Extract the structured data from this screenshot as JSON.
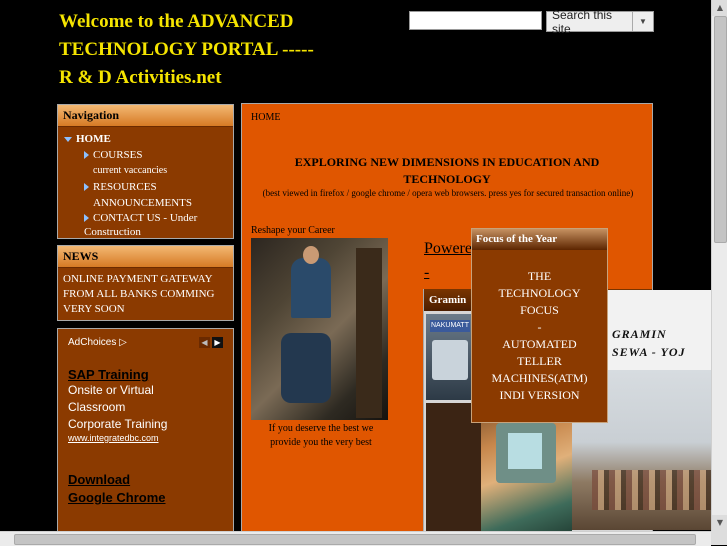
{
  "header": {
    "title_line1": "Welcome to the ADVANCED",
    "title_line2": "TECHNOLOGY PORTAL -----",
    "title_line3": "R & D Activities.net"
  },
  "search": {
    "placeholder": "",
    "button_label": "Search this site"
  },
  "navigation": {
    "heading": "Navigation",
    "items": [
      {
        "label": "HOME",
        "level": 0,
        "expanded": true
      },
      {
        "label": "COURSES",
        "level": 1,
        "has_children": true
      },
      {
        "label": "current vaccancies",
        "level": 1,
        "has_children": false
      },
      {
        "label": "RESOURCES",
        "level": 1,
        "has_children": true
      },
      {
        "label": "ANNOUNCEMENTS",
        "level": 1,
        "has_children": false
      },
      {
        "label": "CONTACT US - Under Construction",
        "level": 1,
        "has_children": true
      }
    ]
  },
  "news": {
    "heading": "NEWS",
    "text": "ONLINE PAYMENT GATEWAY FROM ALL BANKS COMMING VERY SOON"
  },
  "ad": {
    "adchoices_label": "AdChoices",
    "link1": "SAP Training",
    "line1": "Onsite or Virtual",
    "line2": "Classroom",
    "line3": "Corporate Training",
    "url": "www.integratedbc.com",
    "link2_line1": "Download",
    "link2_line2": "Google Chrome"
  },
  "main": {
    "breadcrumb": "HOME",
    "headline": "EXPLORING NEW DIMENSIONS IN EDUCATION AND TECHNOLOGY",
    "subhead": "(best viewed in firefox / google chrome / opera web browsers. press yes for secured transaction online)",
    "career_label": "Reshape your Career",
    "caption": "If you deserve the best we provide you the very best",
    "powered_by": "Powered by -",
    "gramin_heading": "Gramin",
    "card_label": "NAKUMATT"
  },
  "focus": {
    "heading": "Focus of the Year",
    "lines": [
      "THE",
      "TECHNOLOGY",
      "FOCUS",
      "-",
      "AUTOMATED",
      "TELLER",
      "MACHINES(ATM)",
      "INDI VERSION"
    ]
  },
  "right_banner": {
    "line1": "GRAMIN",
    "line2": "SEWA - YOJ"
  },
  "colors": {
    "background": "#000000",
    "title": "#f5e400",
    "panel": "#8b3a00",
    "main_panel": "#e05600",
    "nav_arrow": "#8cc0ff"
  }
}
